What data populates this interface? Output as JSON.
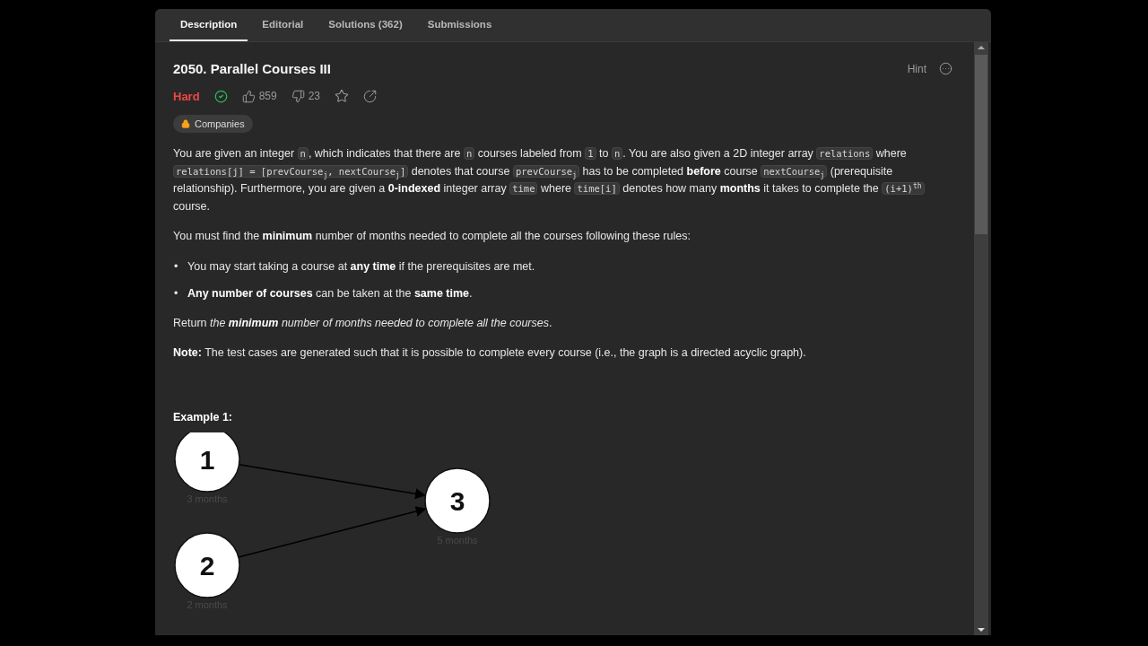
{
  "tabs": [
    {
      "label": "Description",
      "selected": true
    },
    {
      "label": "Editorial",
      "selected": false
    },
    {
      "label": "Solutions (362)",
      "selected": false
    },
    {
      "label": "Submissions",
      "selected": false
    }
  ],
  "problem": {
    "title": "2050. Parallel Courses III",
    "hint": "Hint",
    "difficulty": "Hard",
    "solved": true,
    "likes": "859",
    "dislikes": "23",
    "tag": "Companies"
  },
  "description": [
    {
      "kind": "paragraph",
      "segments": [
        {
          "kind": "text",
          "text": "You are given an integer "
        },
        {
          "kind": "code",
          "text": "n"
        },
        {
          "kind": "text",
          "text": ", which indicates that there are "
        },
        {
          "kind": "code",
          "text": "n"
        },
        {
          "kind": "text",
          "text": " courses labeled from "
        },
        {
          "kind": "code",
          "text": "1"
        },
        {
          "kind": "text",
          "text": " to "
        },
        {
          "kind": "code",
          "text": "n"
        },
        {
          "kind": "text",
          "text": ". You are also given a 2D integer array "
        },
        {
          "kind": "code",
          "text": "relations"
        },
        {
          "kind": "text",
          "text": " where "
        },
        {
          "kind": "code",
          "text": "relations[j] = [prevCourse$_{j}$, nextCourse$_{j}$]"
        },
        {
          "kind": "text",
          "text": " denotes that course "
        },
        {
          "kind": "code",
          "text": "prevCourse$_{j}$"
        },
        {
          "kind": "text",
          "text": " has to be completed **before** course "
        },
        {
          "kind": "code",
          "text": "nextCourse$_{j}$"
        },
        {
          "kind": "text",
          "text": " (prerequisite relationship). Furthermore, you are given a **0-indexed** integer array "
        },
        {
          "kind": "code",
          "text": "time"
        },
        {
          "kind": "text",
          "text": " where "
        },
        {
          "kind": "code",
          "text": "time[i]"
        },
        {
          "kind": "text",
          "text": " denotes how many **months** it takes to complete the "
        },
        {
          "kind": "code",
          "text": "(i+1)$^{th}$"
        },
        {
          "kind": "text",
          "text": " course."
        }
      ]
    },
    {
      "kind": "paragraph",
      "segments": [
        {
          "kind": "text",
          "text": "You must find the **minimum** number of months needed to complete all the courses following these rules:"
        }
      ]
    },
    {
      "kind": "bullets",
      "items": [
        {
          "marker": "•",
          "text": "You may start taking a course at **any time** if the prerequisites are met."
        },
        {
          "marker": "•",
          "text": "**Any number of courses** can be taken at the **same time**."
        }
      ]
    },
    {
      "kind": "paragraph",
      "segments": [
        {
          "kind": "text",
          "text": "Return "
        },
        {
          "kind": "italic",
          "text": "the **minimum** number of months needed to complete all the courses"
        },
        {
          "kind": "text",
          "text": "."
        }
      ]
    },
    {
      "kind": "paragraph",
      "segments": [
        {
          "kind": "text",
          "text": "**Note:** The test cases are generated such that it is possible to complete every course (i.e., the graph is a directed acyclic graph)."
        }
      ]
    }
  ],
  "example": {
    "title": "Example 1:",
    "diagram": {
      "nodes": [
        {
          "label": "1",
          "caption": "3 months"
        },
        {
          "label": "2",
          "caption": "2 months"
        },
        {
          "label": "3",
          "caption": "5 months"
        }
      ]
    }
  }
}
